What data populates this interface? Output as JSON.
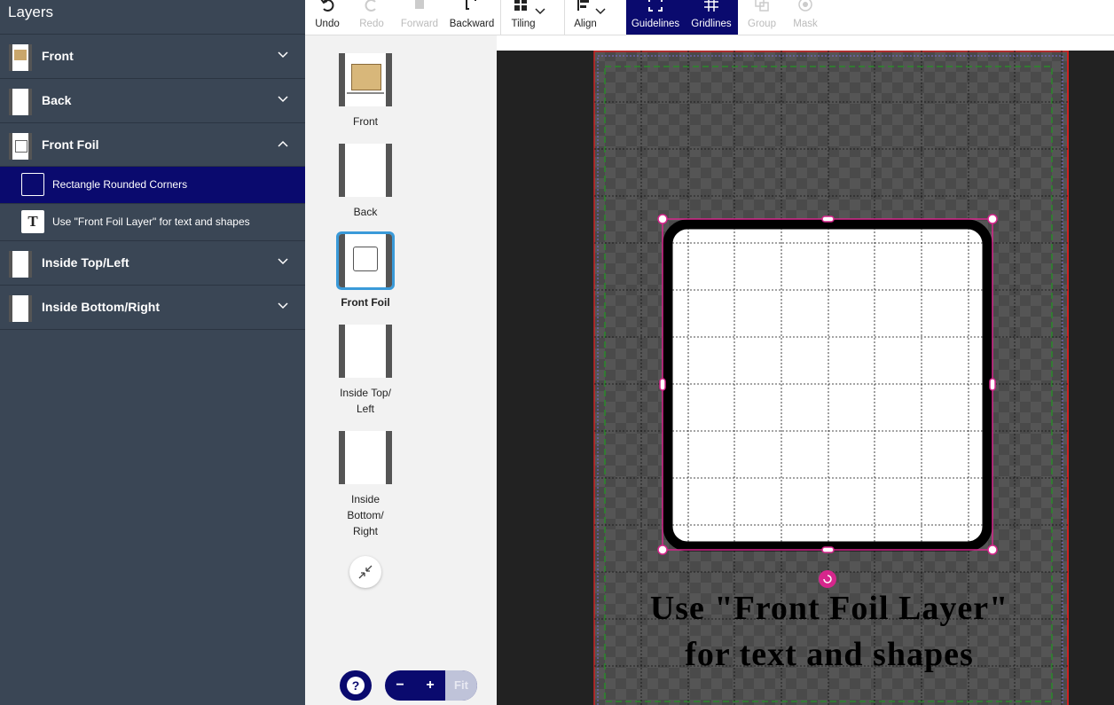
{
  "layers_panel": {
    "title": "Layers",
    "items": [
      {
        "label": "Front",
        "expanded": false
      },
      {
        "label": "Back",
        "expanded": false
      },
      {
        "label": "Front Foil",
        "expanded": true
      },
      {
        "label": "Inside Top/Left",
        "expanded": false
      },
      {
        "label": "Inside Bottom/Right",
        "expanded": false
      }
    ],
    "sub_items": [
      {
        "label": "Rectangle Rounded Corners",
        "icon": "rectangle-icon",
        "selected": true
      },
      {
        "label": "Use \"Front Foil Layer\" for text and shapes",
        "icon": "text-icon",
        "selected": false
      }
    ]
  },
  "toolbar": {
    "items": [
      {
        "label": "Undo",
        "state": "enabled"
      },
      {
        "label": "Redo",
        "state": "disabled"
      },
      {
        "label": "Forward",
        "state": "disabled"
      },
      {
        "label": "Backward",
        "state": "enabled"
      },
      {
        "label": "Tiling",
        "state": "enabled"
      },
      {
        "label": "Align",
        "state": "enabled"
      },
      {
        "label": "Guidelines",
        "state": "active"
      },
      {
        "label": "Gridlines",
        "state": "active"
      },
      {
        "label": "Group",
        "state": "disabled"
      },
      {
        "label": "Mask",
        "state": "disabled"
      }
    ]
  },
  "pages": [
    {
      "label": "Front",
      "selected": false
    },
    {
      "label": "Back",
      "selected": false
    },
    {
      "label": "Front Foil",
      "selected": true
    },
    {
      "label": "Inside Top/\nLeft",
      "selected": false
    },
    {
      "label": "Inside\nBottom/\nRight",
      "selected": false
    }
  ],
  "canvas": {
    "text_line1": "Use \"Front Foil Layer\"",
    "text_line2": "for text and shapes"
  },
  "zoom": {
    "minus": "−",
    "plus": "+",
    "fit": "Fit"
  },
  "help": "?",
  "colors": {
    "panel_bg": "#3a4655",
    "selected_bg": "#0a0a6e",
    "selection_magenta": "#d6268c",
    "page_border_red": "#cc2222",
    "guide_green": "#2a8a2a"
  }
}
